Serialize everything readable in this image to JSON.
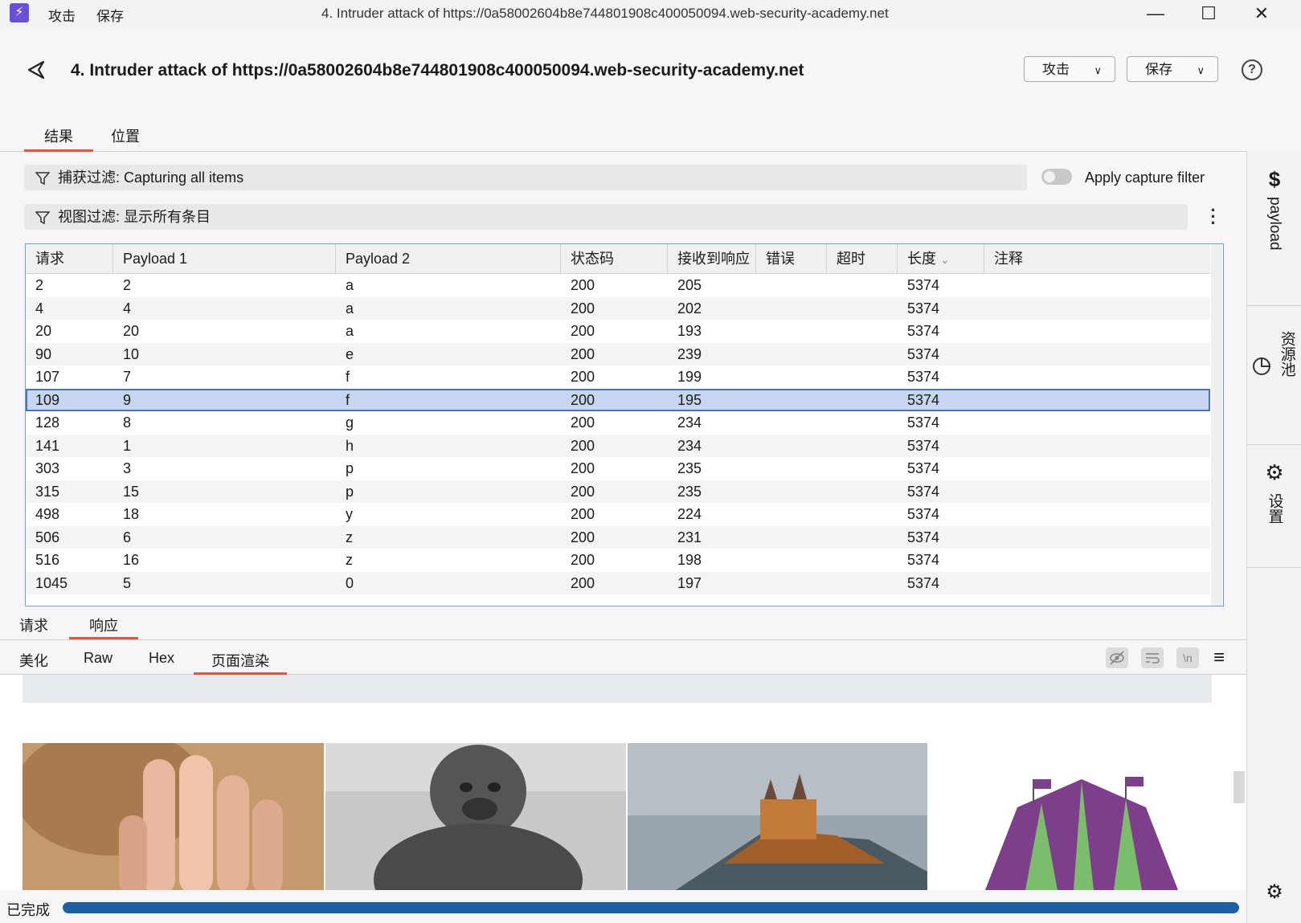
{
  "titlebar": {
    "menu_attack": "攻击",
    "menu_save": "保存",
    "window_title": "4. Intruder attack of https://0a58002604b8e744801908c400050094.web-security-academy.net",
    "minimize": "—",
    "maximize": "☐",
    "close": "✕"
  },
  "header": {
    "title": "4. Intruder attack of https://0a58002604b8e744801908c400050094.web-security-academy.net",
    "attack_btn": "攻击",
    "save_btn": "保存",
    "help": "?"
  },
  "tabs": [
    {
      "label": "结果",
      "active": true
    },
    {
      "label": "位置",
      "active": false
    }
  ],
  "filters": {
    "capture_label": "捕获过滤: Capturing all items",
    "toggle_label": "Apply capture filter",
    "view_label": "视图过滤: 显示所有条目"
  },
  "table": {
    "columns": [
      "请求",
      "Payload 1",
      "Payload 2",
      "状态码",
      "接收到响应",
      "错误",
      "超时",
      "长度",
      "注释"
    ],
    "sort_indicator": "⌄",
    "rows": [
      [
        "2",
        "2",
        "a",
        "200",
        "205",
        "",
        "",
        "5374",
        ""
      ],
      [
        "4",
        "4",
        "a",
        "200",
        "202",
        "",
        "",
        "5374",
        ""
      ],
      [
        "20",
        "20",
        "a",
        "200",
        "193",
        "",
        "",
        "5374",
        ""
      ],
      [
        "90",
        "10",
        "e",
        "200",
        "239",
        "",
        "",
        "5374",
        ""
      ],
      [
        "107",
        "7",
        "f",
        "200",
        "199",
        "",
        "",
        "5374",
        ""
      ],
      [
        "109",
        "9",
        "f",
        "200",
        "195",
        "",
        "",
        "5374",
        ""
      ],
      [
        "128",
        "8",
        "g",
        "200",
        "234",
        "",
        "",
        "5374",
        ""
      ],
      [
        "141",
        "1",
        "h",
        "200",
        "234",
        "",
        "",
        "5374",
        ""
      ],
      [
        "303",
        "3",
        "p",
        "200",
        "235",
        "",
        "",
        "5374",
        ""
      ],
      [
        "315",
        "15",
        "p",
        "200",
        "235",
        "",
        "",
        "5374",
        ""
      ],
      [
        "498",
        "18",
        "y",
        "200",
        "224",
        "",
        "",
        "5374",
        ""
      ],
      [
        "506",
        "6",
        "z",
        "200",
        "231",
        "",
        "",
        "5374",
        ""
      ],
      [
        "516",
        "16",
        "z",
        "200",
        "198",
        "",
        "",
        "5374",
        ""
      ],
      [
        "1045",
        "5",
        "0",
        "200",
        "197",
        "",
        "",
        "5374",
        ""
      ]
    ],
    "selected_row": 5
  },
  "sub_tabs": [
    {
      "label": "请求",
      "active": false
    },
    {
      "label": "响应",
      "active": true
    }
  ],
  "view_tabs": [
    {
      "label": "美化",
      "active": false
    },
    {
      "label": "Raw",
      "active": false
    },
    {
      "label": "Hex",
      "active": false
    },
    {
      "label": "页面渲染",
      "active": true
    }
  ],
  "view_icons": [
    "eye-off-icon",
    "wrap-icon",
    "newline-icon",
    "menu-icon"
  ],
  "newline_icon_text": "\\n",
  "sidebar": {
    "payload": "payload",
    "resource_pool": "资源池",
    "settings": "设置"
  },
  "status": {
    "text": "已完成",
    "progress": 1.0
  },
  "colors": {
    "accent": "#e7543b",
    "selection": "#c5d6ee",
    "progress": "#1f5fa6",
    "logo": "#6a4fd8"
  }
}
